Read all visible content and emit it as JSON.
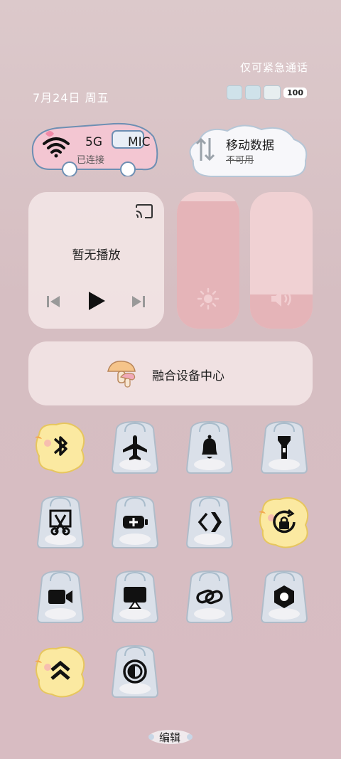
{
  "status": {
    "emergency_calls_text": "仅可紧急通话",
    "date_text": "7月24日 周五",
    "battery_level": "100"
  },
  "connectivity": {
    "wifi_label": "5G",
    "wifi_sub": "已连接",
    "wifi_extra": "MIC",
    "mobile_label": "移动数据",
    "mobile_sub": "不可用"
  },
  "media": {
    "now_playing": "暂无播放"
  },
  "sliders": {
    "brightness_level": 0.93,
    "volume_level": 0.25
  },
  "device_center": {
    "label": "融合设备中心"
  },
  "quick_settings": [
    {
      "name": "bluetooth",
      "icon": "bluetooth-icon",
      "sticker": "chick"
    },
    {
      "name": "airplane-mode",
      "icon": "airplane-icon",
      "sticker": "bag"
    },
    {
      "name": "notifications",
      "icon": "bell-icon",
      "sticker": "bag"
    },
    {
      "name": "flashlight",
      "icon": "flashlight-icon",
      "sticker": "bag"
    },
    {
      "name": "screenshot",
      "icon": "scissors-icon",
      "sticker": "bag"
    },
    {
      "name": "power-saving",
      "icon": "battery-plus-icon",
      "sticker": "bag"
    },
    {
      "name": "nfc-share",
      "icon": "share-arrow-icon",
      "sticker": "bag"
    },
    {
      "name": "rotation-lock",
      "icon": "rotation-lock-icon",
      "sticker": "chick"
    },
    {
      "name": "screen-record",
      "icon": "video-camera-icon",
      "sticker": "bag"
    },
    {
      "name": "screen-cast",
      "icon": "screen-cast-icon",
      "sticker": "bag"
    },
    {
      "name": "link",
      "icon": "link-icon",
      "sticker": "bag"
    },
    {
      "name": "settings-hex",
      "icon": "hexagon-icon",
      "sticker": "bag"
    },
    {
      "name": "performance-mode",
      "icon": "double-chevron-up-icon",
      "sticker": "chick"
    },
    {
      "name": "eye-comfort",
      "icon": "contrast-icon",
      "sticker": "bag"
    }
  ],
  "footer": {
    "edit_label": "编辑"
  },
  "colors": {
    "accent_pink": "#e5b4b8",
    "tile_bg": "#f5e8e8",
    "icon_black": "#111111",
    "chick_yellow": "#fbe9a1",
    "bag_blue": "#d7e6f0"
  }
}
